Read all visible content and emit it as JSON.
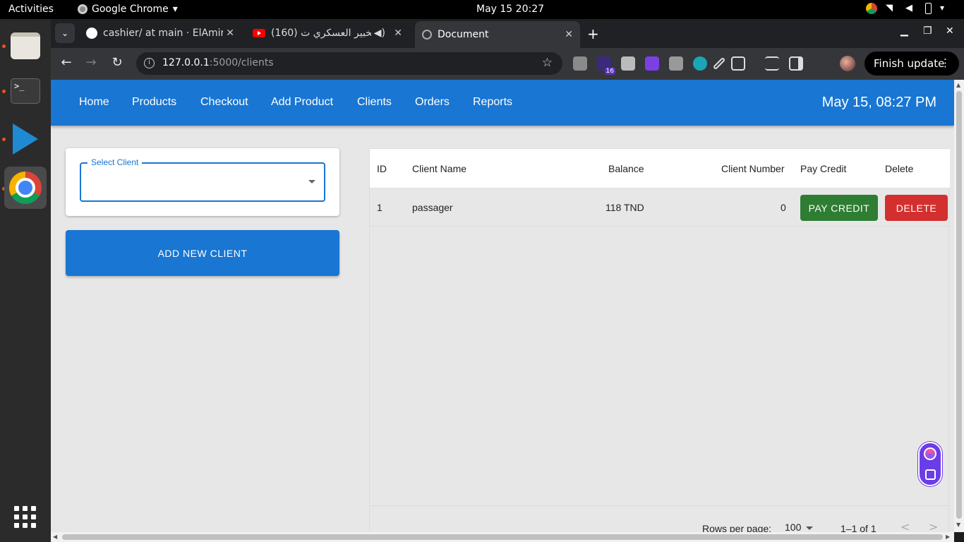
{
  "system": {
    "activities": "Activities",
    "app_name": "Google Chrome",
    "clock": "May 15  20:27"
  },
  "browser": {
    "tabs": [
      {
        "title": "cashier/ at main · ElAmir",
        "icon": "github-icon"
      },
      {
        "title": "(160) الخبير العسكري ت",
        "icon": "youtube-icon"
      },
      {
        "title": "Document",
        "icon": "globe-icon"
      }
    ],
    "url_host": "127.0.0.1",
    "url_path": ":5000/clients",
    "extension_badge": "16",
    "finish_update": "Finish update"
  },
  "app": {
    "nav": [
      "Home",
      "Products",
      "Checkout",
      "Add Product",
      "Clients",
      "Orders",
      "Reports"
    ],
    "datetime": "May 15, 08:27 PM",
    "select_client_label": "Select Client",
    "add_client_button": "ADD NEW CLIENT",
    "table": {
      "columns": [
        "ID",
        "Client Name",
        "Balance",
        "Client Number",
        "Pay Credit",
        "Delete"
      ],
      "rows": [
        {
          "id": "1",
          "name": "passager",
          "balance": "118 TND",
          "number": "0",
          "pay_label": "PAY CREDIT",
          "delete_label": "DELETE"
        }
      ],
      "rows_per_page_label": "Rows per page:",
      "rows_per_page": "100",
      "page_info": "1–1 of 1"
    }
  },
  "colors": {
    "primary": "#1976d2",
    "success": "#2e7d32",
    "error": "#d32f2f"
  }
}
